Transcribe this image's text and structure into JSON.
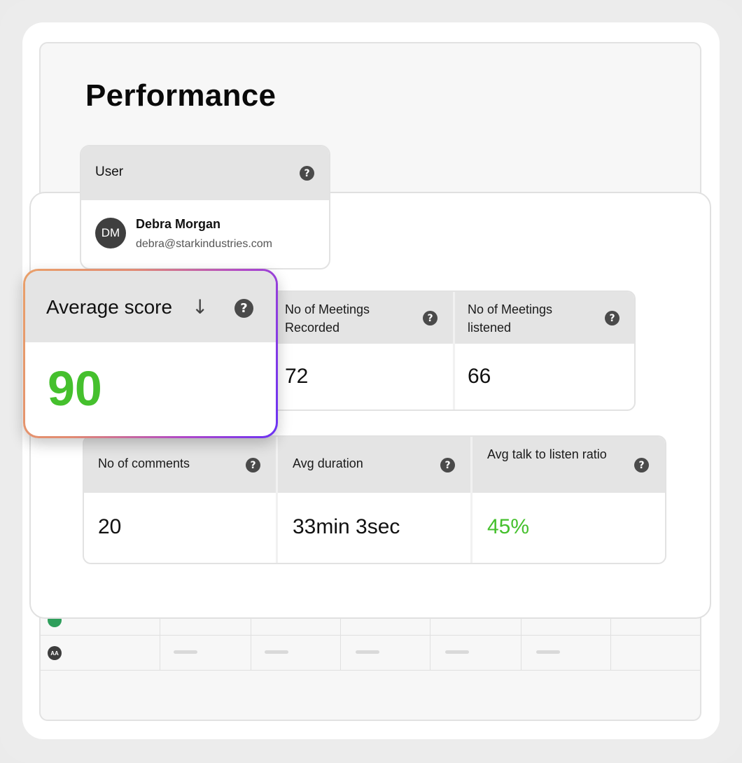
{
  "page": {
    "title": "Performance"
  },
  "user_card": {
    "header": "User",
    "initials": "DM",
    "name": "Debra Morgan",
    "email": "debra@starkindustries.com"
  },
  "average_score": {
    "label": "Average score",
    "sort_icon": "arrow-down-icon",
    "value": "90",
    "value_color": "#45c02d"
  },
  "meetings": [
    {
      "label": "No of Meetings Recorded",
      "value": "72"
    },
    {
      "label": "No of Meetings listened",
      "value": "66"
    }
  ],
  "stats": [
    {
      "label": "No of comments",
      "value": "20"
    },
    {
      "label": "Avg duration",
      "value": "33min 3sec"
    },
    {
      "label": "Avg talk to listen ratio",
      "value": "45%",
      "value_color": "#45c02d"
    }
  ],
  "background_table": {
    "row_avatar": "AA"
  },
  "help_icon_glyph": "?"
}
